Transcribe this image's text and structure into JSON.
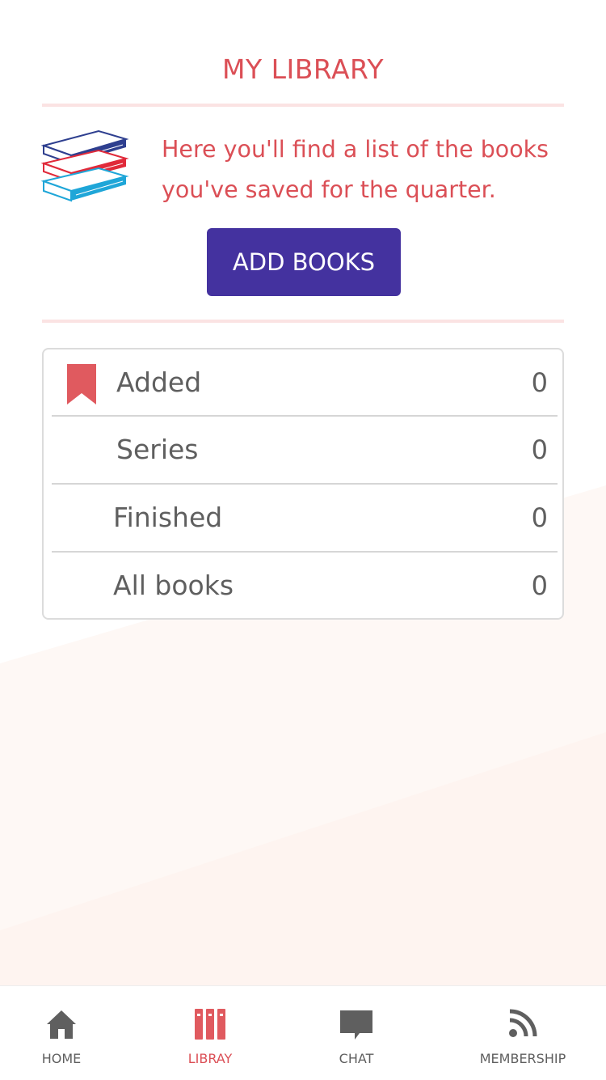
{
  "header": {
    "title": "MY LIBRARY"
  },
  "intro": {
    "icon": "books-stack-icon",
    "text": "Here you'll find a list of the books you've saved for the quarter."
  },
  "add_button": {
    "label": "ADD BOOKS"
  },
  "list": {
    "rows": [
      {
        "label": "Added",
        "count": "0",
        "icon": "bookmark-icon"
      },
      {
        "label": "Series",
        "count": "0"
      },
      {
        "label": "Finished",
        "count": "0"
      },
      {
        "label": "All books",
        "count": "0"
      }
    ]
  },
  "tabbar": {
    "tabs": [
      {
        "label": "HOME",
        "icon": "home-icon",
        "active": false
      },
      {
        "label": "LIBRAY",
        "icon": "library-icon",
        "active": true
      },
      {
        "label": "CHAT",
        "icon": "chat-icon",
        "active": false
      },
      {
        "label": "MEMBERSHIP",
        "icon": "rss-icon",
        "active": false
      }
    ]
  },
  "colors": {
    "accent": "#db4f56",
    "button": "#44329f",
    "text": "#5f5f5f",
    "divider": "#fbe3e3"
  }
}
